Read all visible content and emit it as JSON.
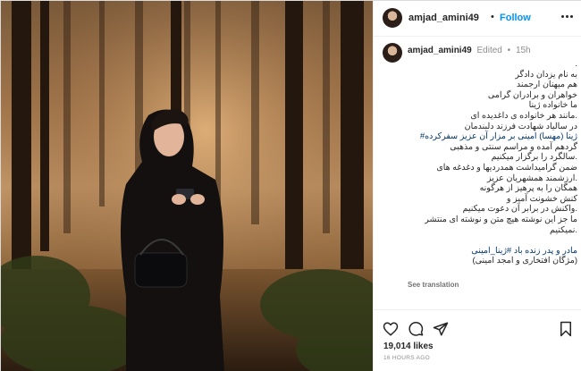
{
  "post": {
    "username": "amjad_amini49",
    "header_dot": "•",
    "follow_label": "Follow",
    "edited_label": "Edited",
    "dot": "•",
    "time": "15h",
    "caption_lines": [
      ".",
      "به نام یزدان دادگر",
      "هم میهنان ارجمند",
      "خواهران و برادران گرامی",
      "ما خانواده ژینا",
      ".مانند هر خانواده ی داغدیده ای",
      "در سالیاد شهادت فرزند دلبندمان",
      "ژینا (مهسا) امینی بر مزار آن عزیز سفرکرده#",
      "گردهم آمده و مراسم سنتی و مذهبی",
      ".سالگرد را برگزار میکنیم",
      "ضمن گرامیداشت همدردیها و دغدغه های",
      ".ارزشمند همشهریان عزیز",
      "همگان را به پرهیز از هرگونه",
      "کنش خشونت آمیز و",
      ".واکنش در برابر آن دعوت میکنیم",
      "ما جز این نوشته هیچ متن و نوشته ای منتشر",
      ".نمیکنیم"
    ],
    "signature_tag": "مادر و پدر زنده باد #ژینا_امینی",
    "signature_names": "(مژگان افتخاری و امجد امینی)",
    "see_translation": "See translation",
    "likes": "19,014 likes",
    "posted_ago": "16 HOURS AGO"
  },
  "icons": {
    "more": "more-horizontal-icon",
    "like": "heart-icon",
    "comment": "comment-icon",
    "share": "share-icon",
    "save": "bookmark-icon"
  },
  "colors": {
    "follow": "#0095f6",
    "text": "#262626",
    "muted": "#8e8e8e",
    "hashtag": "#00376b"
  }
}
